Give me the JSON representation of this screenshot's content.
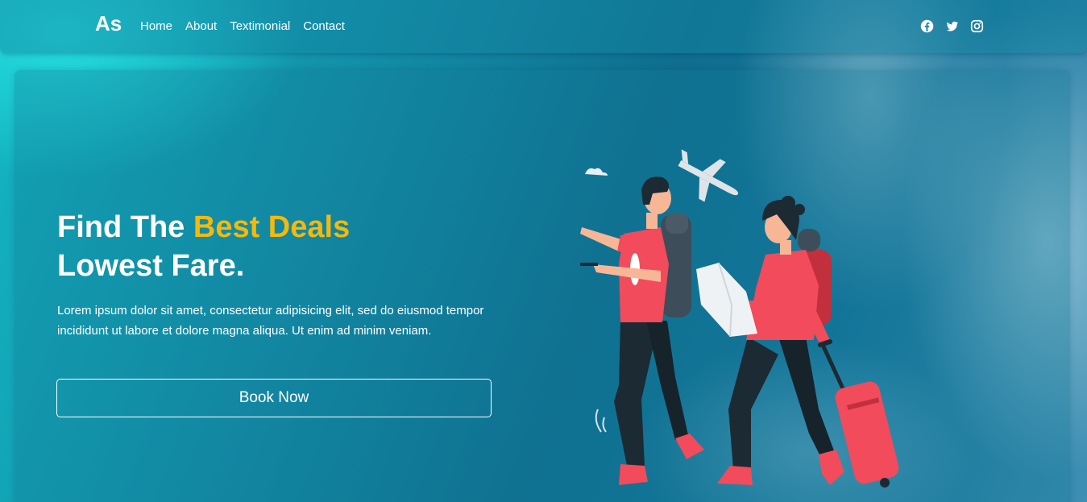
{
  "brand": {
    "logo": "As"
  },
  "nav": {
    "items": [
      "Home",
      "About",
      "Textimonial",
      "Contact"
    ]
  },
  "socials": [
    "facebook-icon",
    "twitter-icon",
    "instagram-icon"
  ],
  "hero": {
    "headline_part1": "Find The ",
    "headline_accent": "Best Deals",
    "headline_line2": "Lowest Fare.",
    "description": "Lorem ipsum dolor sit amet, consectetur adipisicing elit, sed do eiusmod tempor incididunt ut labore et dolore magna aliqua. Ut enim ad minim veniam.",
    "button_label": "Book Now"
  },
  "colors": {
    "accent": "#f5b90c",
    "text": "#ffffff",
    "illustration_red": "#f24b5b",
    "illustration_dark": "#1c2a33"
  }
}
